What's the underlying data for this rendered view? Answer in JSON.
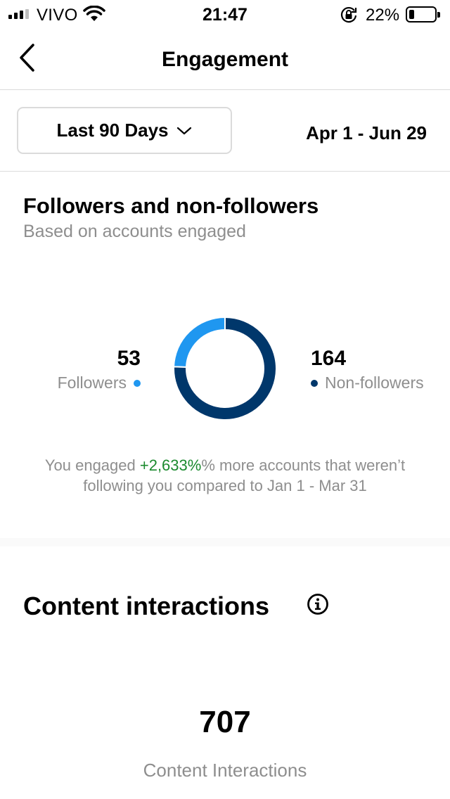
{
  "status_bar": {
    "carrier": "VIVO",
    "time": "21:47",
    "battery_percent": "22%",
    "battery_level": 0.22,
    "signal_bars_active": 3,
    "signal_bars_total": 4,
    "icons": [
      "signal-icon",
      "wifi-icon",
      "rotation-lock-icon",
      "battery-icon"
    ]
  },
  "header": {
    "title": "Engagement",
    "back_icon": "chevron-left-icon"
  },
  "filter": {
    "range_label": "Last 90 Days",
    "range_icon": "chevron-down-icon",
    "date_range": "Apr 1 - Jun 29"
  },
  "followers": {
    "title": "Followers and non-followers",
    "subtitle": "Based on accounts engaged",
    "followers_value": "53",
    "followers_label": "Followers",
    "non_followers_value": "164",
    "non_followers_label": "Non-followers",
    "compare_prefix": "You engaged ",
    "compare_highlight": "+2,633%",
    "compare_suffix": "% more accounts that weren’t following you compared to Jan 1 - Mar 31"
  },
  "chart_data": {
    "type": "pie",
    "donut": true,
    "categories": [
      "Followers",
      "Non-followers"
    ],
    "values": [
      53,
      164
    ],
    "colors": [
      "#1f97f0",
      "#00376b"
    ]
  },
  "content_interactions": {
    "title": "Content interactions",
    "info_icon": "info-icon",
    "value": "707",
    "label": "Content Interactions"
  },
  "colors": {
    "followers": "#1f97f0",
    "non_followers": "#00376b",
    "positive": "#1b8a2e",
    "secondary_text": "#8e8e8e",
    "divider": "#dbdbdb"
  }
}
